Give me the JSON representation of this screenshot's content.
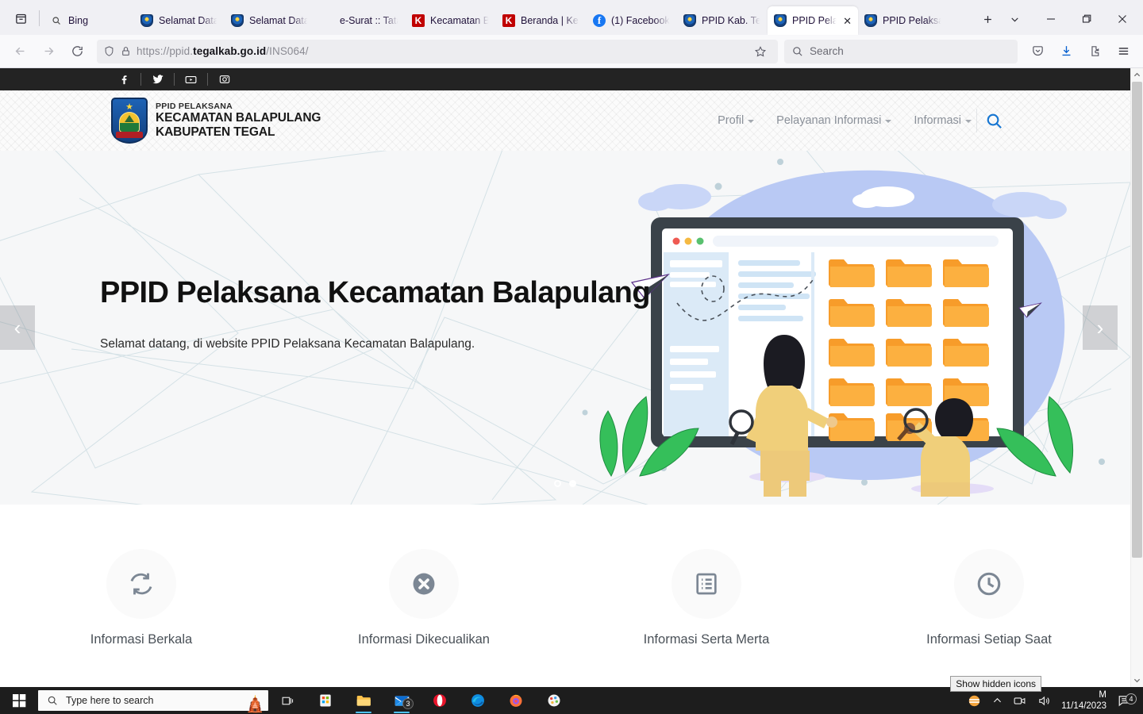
{
  "browser": {
    "tabs": [
      {
        "title": "Bing",
        "favicon": "bing-icon",
        "active": false
      },
      {
        "title": "Selamat Datang",
        "favicon": "crest-icon",
        "active": false
      },
      {
        "title": "Selamat Datang",
        "favicon": "crest-icon",
        "active": false
      },
      {
        "title": "e-Surat :: Tata Naskah",
        "favicon": "blank-icon",
        "active": false
      },
      {
        "title": "Kecamatan Balapulang",
        "favicon": "k-icon",
        "active": false
      },
      {
        "title": "Beranda | Kecamatan",
        "favicon": "k-icon",
        "active": false
      },
      {
        "title": "(1) Facebook",
        "favicon": "facebook-icon",
        "active": false
      },
      {
        "title": "PPID Kab. Tegal",
        "favicon": "crest-icon",
        "active": false
      },
      {
        "title": "PPID Pelaksana",
        "favicon": "crest-icon",
        "active": true
      },
      {
        "title": "PPID Pelaksana",
        "favicon": "crest-icon",
        "active": false
      }
    ],
    "new_tab_label": "+",
    "list_all_tabs_label": "∨",
    "minimize_label": "—",
    "maximize_label": "❑",
    "close_label": "✕",
    "url": {
      "scheme": "https://ppid.",
      "domain": "tegalkab.go.id",
      "path": "/INS064/"
    },
    "search_placeholder": "Search",
    "back_label": "←",
    "forward_label": "→",
    "reload_label": "⟳"
  },
  "site": {
    "social": [
      {
        "name": "facebook-icon",
        "glyph": "f"
      },
      {
        "name": "twitter-icon",
        "glyph": "t"
      },
      {
        "name": "youtube-icon",
        "glyph": "y"
      },
      {
        "name": "instagram-icon",
        "glyph": "i"
      }
    ],
    "logo": {
      "line1": "PPID PELAKSANA",
      "line2": "KECAMATAN BALAPULANG",
      "line3": "KABUPATEN TEGAL"
    },
    "nav": [
      {
        "label": "Profil",
        "has_dropdown": true
      },
      {
        "label": "Pelayanan Informasi",
        "has_dropdown": true
      },
      {
        "label": "Informasi",
        "has_dropdown": true
      }
    ],
    "search_icon": "search-icon",
    "accent_color": "#1877d2",
    "hero": {
      "title": "PPID Pelaksana Kecamatan Balapulang",
      "subtitle": "Selamat datang, di website PPID Pelaksana Kecamatan Balapulang.",
      "prev_label": "‹",
      "next_label": "›",
      "slides": 2,
      "active_slide": 2
    },
    "services": [
      {
        "label": "Informasi Berkala",
        "icon": "refresh-icon"
      },
      {
        "label": "Informasi Dikecualikan",
        "icon": "close-circle-icon"
      },
      {
        "label": "Informasi Serta Merta",
        "icon": "list-document-icon"
      },
      {
        "label": "Informasi Setiap Saat",
        "icon": "clock-icon"
      }
    ]
  },
  "taskbar": {
    "search_placeholder": "Type here to search",
    "mail_badge": "3",
    "notification_badge": "4",
    "date": "11/14/2023",
    "time": "M",
    "tooltip": "Show hidden icons",
    "apps": [
      {
        "name": "task-view-icon"
      },
      {
        "name": "microsoft-store-icon"
      },
      {
        "name": "file-explorer-icon"
      },
      {
        "name": "mail-icon"
      },
      {
        "name": "opera-icon"
      },
      {
        "name": "microsoft-edge-icon"
      },
      {
        "name": "firefox-icon"
      },
      {
        "name": "paint-icon"
      }
    ]
  }
}
